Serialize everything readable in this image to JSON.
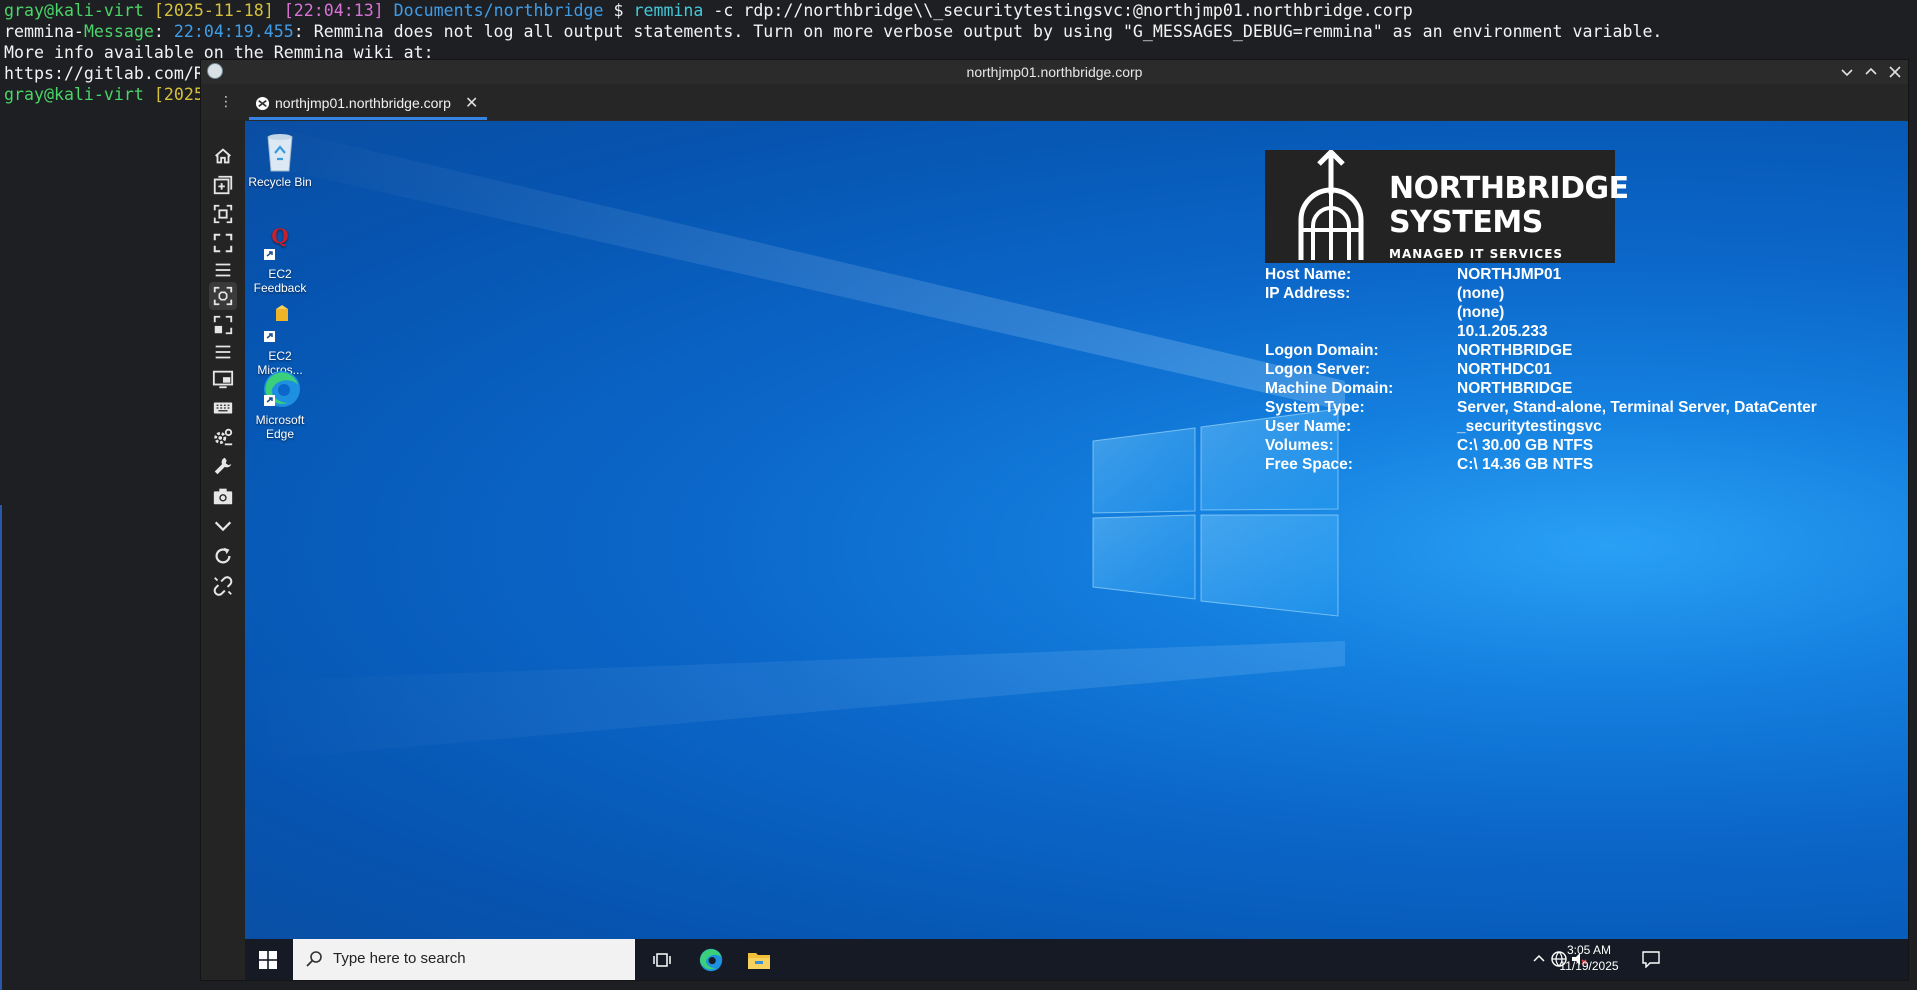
{
  "terminal": {
    "line1": {
      "user": "gray@kali-virt",
      "date": "[2025-11-18]",
      "time": "[22:04:13]",
      "cwd": "Documents/northbridge",
      "prompt": "$",
      "cmd": "remmina",
      "args": "-c rdp://northbridge\\\\_securitytestingsvc:@northjmp01.northbridge.corp"
    },
    "line2": {
      "src1": "remmina-",
      "src2": "Message",
      "ts": "22:04:19.455",
      "msg": ": Remmina does not log all output statements. Turn on more verbose output by using \"G_MESSAGES_DEBUG=remmina\" as an environment variable."
    },
    "line3": "More info available on the Remmina wiki at:",
    "line4": "https://gitlab.com/R",
    "line5": {
      "user": "gray@kali-virt",
      "date": "[2025"
    }
  },
  "window": {
    "title": "northjmp01.northbridge.corp",
    "tab_label": "northjmp01.northbridge.corp",
    "tab_close": "✕",
    "menu": "⋮"
  },
  "toolbar_icons": [
    "home-icon",
    "new-tab-icon",
    "fit-window-icon",
    "fullscreen-icon",
    "menu-icon",
    "scale-icon",
    "dynamic-resize-icon",
    "menu-icon-2",
    "multi-monitor-icon",
    "keyboard-icon",
    "preferences-icon",
    "tools-icon",
    "screenshot-icon",
    "minimize-icon",
    "reconnect-icon",
    "disconnect-icon"
  ],
  "desktop": {
    "icons": [
      {
        "label": "Recycle Bin"
      },
      {
        "label": "EC2 Feedback"
      },
      {
        "label": "EC2 Micros..."
      },
      {
        "label": "Microsoft Edge"
      }
    ],
    "bginfo": {
      "logo_line1": "NORTHBRIDGE",
      "logo_line2": "SYSTEMS",
      "logo_line3": "MANAGED IT SERVICES",
      "host_label": "Host Name:",
      "host": "NORTHJMP01",
      "ip_label": "IP Address:",
      "ip1": "(none)",
      "ip2": "(none)",
      "ip3": "10.1.205.233",
      "logon_domain_label": "Logon Domain:",
      "logon_domain": "NORTHBRIDGE",
      "logon_server_label": "Logon Server:",
      "logon_server": "NORTHDC01",
      "machine_domain_label": "Machine Domain:",
      "machine_domain": "NORTHBRIDGE",
      "system_type_label": "System Type:",
      "system_type": "Server, Stand-alone, Terminal Server, DataCenter",
      "user_label": "User Name:",
      "user": "_securitytestingsvc",
      "volumes_label": "Volumes:",
      "volumes": "C:\\ 30.00 GB NTFS",
      "free_label": "Free Space:",
      "free": "C:\\ 14.36 GB NTFS"
    }
  },
  "taskbar": {
    "search_placeholder": "Type here to search",
    "time": "3:05 AM",
    "date": "11/19/2025"
  },
  "colors": {
    "accent": "#3584e4",
    "desktop": "#0b67c9",
    "taskbar": "#151a24"
  }
}
